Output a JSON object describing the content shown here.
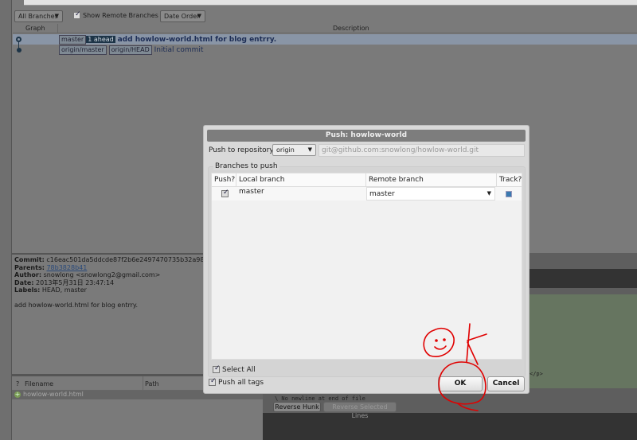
{
  "toolbar": {
    "branches": "All Branches",
    "show_remote": "Show Remote Branches",
    "order": "Date Order"
  },
  "history": {
    "col_graph": "Graph",
    "col_desc": "Description",
    "rows": [
      {
        "tags": [
          "master"
        ],
        "ahead": "1 ahead",
        "message": "add howlow-world.html for blog entrry."
      },
      {
        "tags": [
          "origin/master",
          "origin/HEAD"
        ],
        "message": "Initial commit"
      }
    ]
  },
  "details": {
    "commit_label": "Commit:",
    "commit": "c16eac501da5ddcde87f2b6e2497470735b32a98 [c1",
    "parents_label": "Parents:",
    "parents": "78b3828b41",
    "author_label": "Author:",
    "author": "snowlong <snowlong2@gmail.com>",
    "date_label": "Date:",
    "date": "2013年5月31日 23:47:14",
    "labels_label": "Labels:",
    "labels": "HEAD, master",
    "message": "add howlow-world.html for blog entrry."
  },
  "files": {
    "col_status": "?",
    "col_filename": "Filename",
    "col_path": "Path",
    "rows": [
      {
        "name": "howlow-world.html"
      }
    ]
  },
  "diff": {
    "tail": "</p>",
    "nonewline": "\\ No newline at end of file",
    "reverse_hunk": "Reverse Hunk",
    "reverse_lines": "Reverse Selected Lines"
  },
  "dialog": {
    "title": "Push: howlow-world",
    "repo_label": "Push to repository:",
    "repo": "origin",
    "repo_url": "git@github.com:snowlong/howlow-world.git",
    "group": "Branches to push",
    "col_push": "Push?",
    "col_local": "Local branch",
    "col_remote": "Remote branch",
    "col_track": "Track?",
    "branches": [
      {
        "push": true,
        "local": "master",
        "remote": "master",
        "track": false
      }
    ],
    "select_all": "Select All",
    "push_all_tags": "Push all tags",
    "ok": "OK",
    "cancel": "Cancel"
  },
  "colors": {
    "annotation": "#e00000",
    "selected_row": "#8995a6",
    "diff_bg": "#667560"
  }
}
